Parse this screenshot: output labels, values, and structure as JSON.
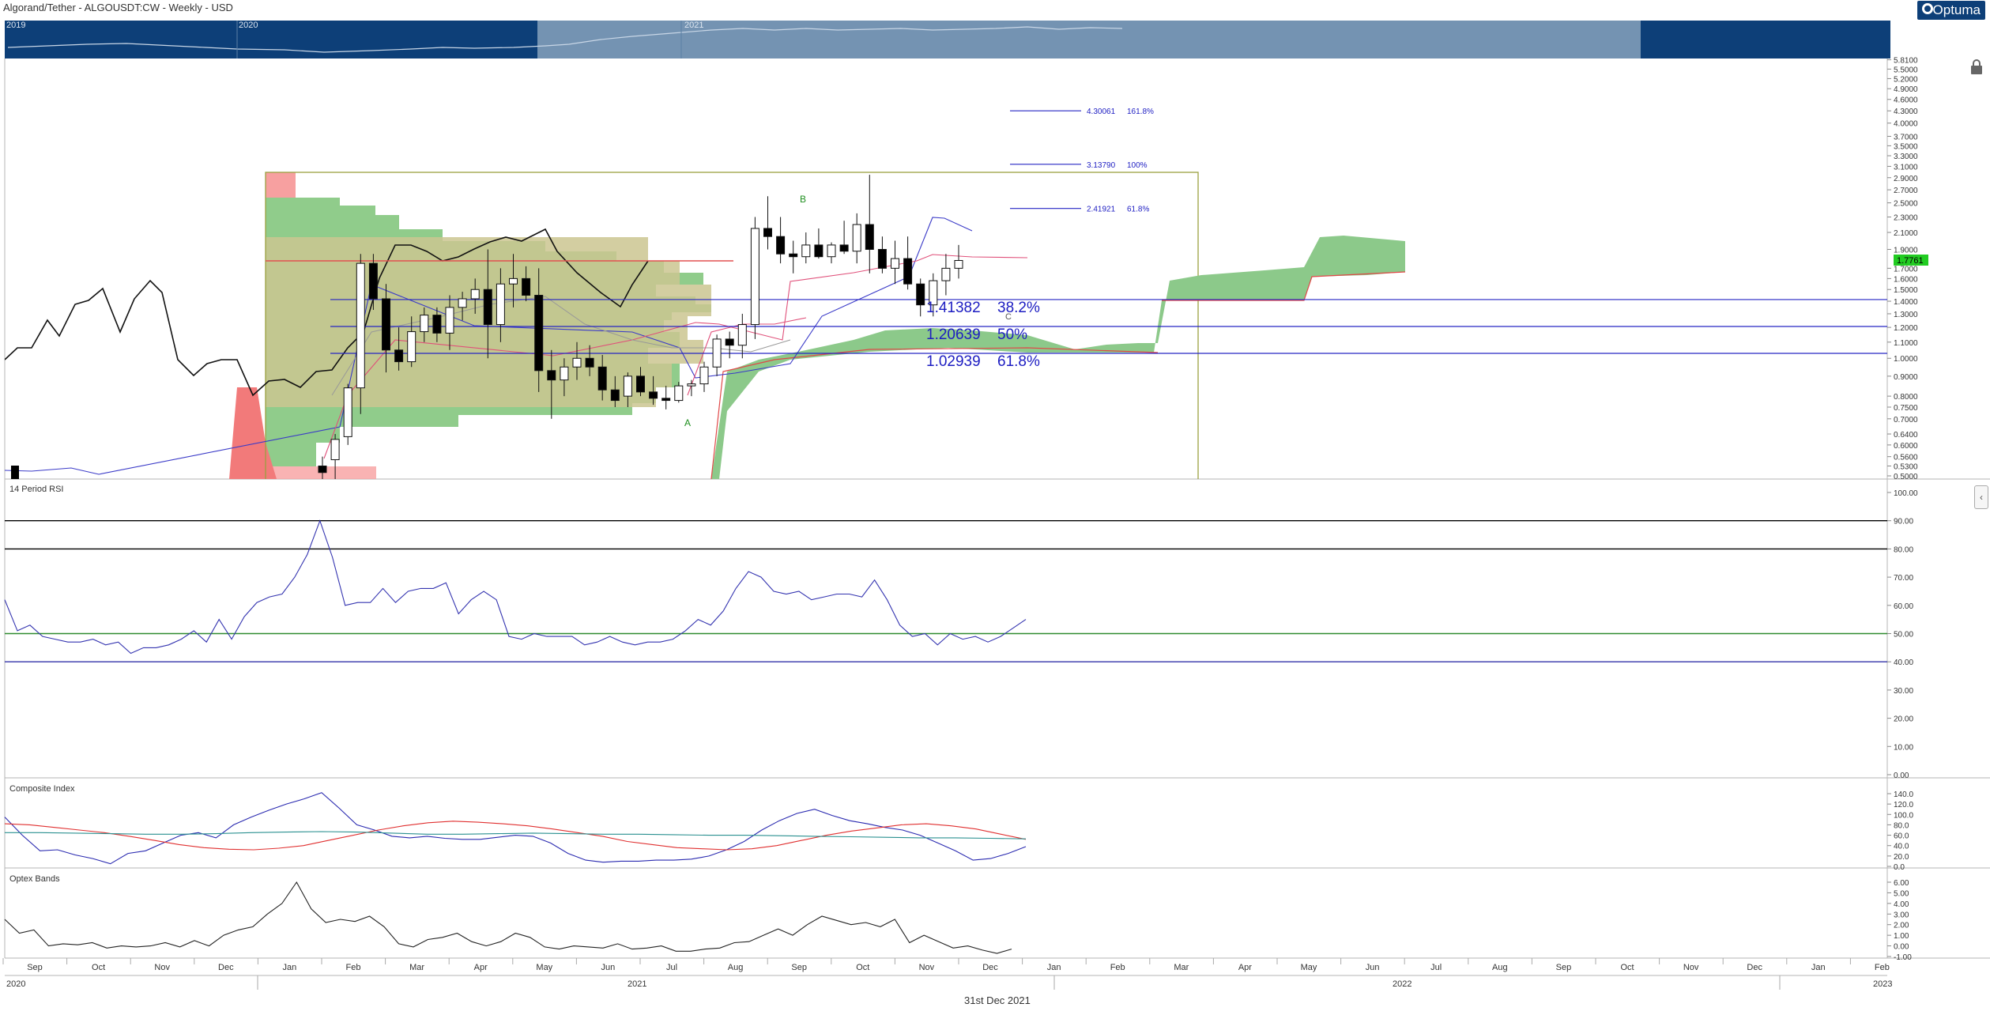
{
  "header": {
    "title": "Algorand/Tether - ALGOUSDT:CW - Weekly - USD",
    "logo_text": "Optuma",
    "footer_date": "31st Dec 2021"
  },
  "navigator": {
    "year_labels": [
      "2019",
      "2020",
      "2021"
    ],
    "colors": {
      "dark": "#0d3f78",
      "selected": "#7493b2"
    }
  },
  "chart_data": [
    {
      "type": "candlestick",
      "panel": "price",
      "scale": "log",
      "ylim": [
        0.5,
        5.8
      ],
      "ticks": [
        "5.8100",
        "5.5000",
        "5.2000",
        "4.9000",
        "4.6000",
        "4.3000",
        "4.0000",
        "3.7000",
        "3.5000",
        "3.3000",
        "3.1000",
        "2.9000",
        "2.7000",
        "2.5000",
        "2.3000",
        "2.1000",
        "1.9000",
        "1.7000",
        "1.6000",
        "1.5000",
        "1.4000",
        "1.3000",
        "1.2000",
        "1.1000",
        "1.0000",
        "0.9000",
        "0.8000",
        "0.7500",
        "0.7000",
        "0.6400",
        "0.6000",
        "0.5600",
        "0.5300",
        "0.5000"
      ],
      "last_price_label": "1.7761",
      "last_price_color": "#22cc22",
      "weeks_start": "2021-01-03",
      "candles": [
        {
          "o": 0.53,
          "h": 0.56,
          "l": 0.49,
          "c": 0.51
        },
        {
          "o": 0.55,
          "h": 0.64,
          "l": 0.48,
          "c": 0.62
        },
        {
          "o": 0.63,
          "h": 0.86,
          "l": 0.6,
          "c": 0.84
        },
        {
          "o": 0.84,
          "h": 1.85,
          "l": 0.72,
          "c": 1.75
        },
        {
          "o": 1.75,
          "h": 1.85,
          "l": 1.33,
          "c": 1.42
        },
        {
          "o": 1.42,
          "h": 1.55,
          "l": 0.92,
          "c": 1.05
        },
        {
          "o": 1.05,
          "h": 1.2,
          "l": 0.93,
          "c": 0.98
        },
        {
          "o": 0.98,
          "h": 1.28,
          "l": 0.95,
          "c": 1.17
        },
        {
          "o": 1.17,
          "h": 1.35,
          "l": 1.1,
          "c": 1.29
        },
        {
          "o": 1.29,
          "h": 1.35,
          "l": 1.1,
          "c": 1.16
        },
        {
          "o": 1.16,
          "h": 1.45,
          "l": 1.05,
          "c": 1.35
        },
        {
          "o": 1.35,
          "h": 1.48,
          "l": 1.25,
          "c": 1.42
        },
        {
          "o": 1.42,
          "h": 1.6,
          "l": 1.3,
          "c": 1.5
        },
        {
          "o": 1.5,
          "h": 1.9,
          "l": 1.0,
          "c": 1.22
        },
        {
          "o": 1.22,
          "h": 1.7,
          "l": 1.1,
          "c": 1.55
        },
        {
          "o": 1.55,
          "h": 1.85,
          "l": 1.35,
          "c": 1.6
        },
        {
          "o": 1.6,
          "h": 1.72,
          "l": 1.4,
          "c": 1.45
        },
        {
          "o": 1.45,
          "h": 1.7,
          "l": 0.82,
          "c": 0.93
        },
        {
          "o": 0.93,
          "h": 1.05,
          "l": 0.7,
          "c": 0.88
        },
        {
          "o": 0.88,
          "h": 1.0,
          "l": 0.8,
          "c": 0.95
        },
        {
          "o": 0.95,
          "h": 1.1,
          "l": 0.88,
          "c": 1.0
        },
        {
          "o": 1.0,
          "h": 1.08,
          "l": 0.9,
          "c": 0.95
        },
        {
          "o": 0.95,
          "h": 1.02,
          "l": 0.78,
          "c": 0.83
        },
        {
          "o": 0.83,
          "h": 0.9,
          "l": 0.75,
          "c": 0.78
        },
        {
          "o": 0.8,
          "h": 0.92,
          "l": 0.75,
          "c": 0.9
        },
        {
          "o": 0.9,
          "h": 0.95,
          "l": 0.8,
          "c": 0.82
        },
        {
          "o": 0.82,
          "h": 0.9,
          "l": 0.76,
          "c": 0.79
        },
        {
          "o": 0.79,
          "h": 0.85,
          "l": 0.74,
          "c": 0.78
        },
        {
          "o": 0.78,
          "h": 0.87,
          "l": 0.77,
          "c": 0.85
        },
        {
          "o": 0.85,
          "h": 0.88,
          "l": 0.8,
          "c": 0.86
        },
        {
          "o": 0.86,
          "h": 0.98,
          "l": 0.82,
          "c": 0.95
        },
        {
          "o": 0.95,
          "h": 1.15,
          "l": 0.9,
          "c": 1.12
        },
        {
          "o": 1.12,
          "h": 1.17,
          "l": 1.0,
          "c": 1.08
        },
        {
          "o": 1.08,
          "h": 1.3,
          "l": 1.0,
          "c": 1.22
        },
        {
          "o": 1.22,
          "h": 2.3,
          "l": 1.12,
          "c": 2.15
        },
        {
          "o": 2.15,
          "h": 2.6,
          "l": 1.9,
          "c": 2.05
        },
        {
          "o": 2.05,
          "h": 2.3,
          "l": 1.75,
          "c": 1.85
        },
        {
          "o": 1.85,
          "h": 2.0,
          "l": 1.65,
          "c": 1.82
        },
        {
          "o": 1.82,
          "h": 2.1,
          "l": 1.75,
          "c": 1.95
        },
        {
          "o": 1.95,
          "h": 2.15,
          "l": 1.8,
          "c": 1.82
        },
        {
          "o": 1.82,
          "h": 1.98,
          "l": 1.75,
          "c": 1.95
        },
        {
          "o": 1.95,
          "h": 2.25,
          "l": 1.85,
          "c": 1.88
        },
        {
          "o": 1.88,
          "h": 2.35,
          "l": 1.75,
          "c": 2.2
        },
        {
          "o": 2.2,
          "h": 2.95,
          "l": 1.65,
          "c": 1.9
        },
        {
          "o": 1.9,
          "h": 2.05,
          "l": 1.65,
          "c": 1.7
        },
        {
          "o": 1.7,
          "h": 2.0,
          "l": 1.55,
          "c": 1.8
        },
        {
          "o": 1.8,
          "h": 2.05,
          "l": 1.5,
          "c": 1.55
        },
        {
          "o": 1.55,
          "h": 1.6,
          "l": 1.28,
          "c": 1.37
        },
        {
          "o": 1.37,
          "h": 1.65,
          "l": 1.28,
          "c": 1.58
        },
        {
          "o": 1.58,
          "h": 1.85,
          "l": 1.45,
          "c": 1.7
        },
        {
          "o": 1.7,
          "h": 1.95,
          "l": 1.6,
          "c": 1.78
        }
      ],
      "fib_retracements": [
        {
          "value": 1.41382,
          "label": "1.41382",
          "pct": "38.2%"
        },
        {
          "value": 1.20639,
          "label": "1.20639",
          "pct": "50%"
        },
        {
          "value": 1.02939,
          "label": "1.02939",
          "pct": "61.8%"
        }
      ],
      "fib_extensions": [
        {
          "value": 4.30061,
          "label": "4.30061",
          "pct": "161.8%"
        },
        {
          "value": 3.1379,
          "label": "3.13790",
          "pct": "100%"
        },
        {
          "value": 2.41921,
          "label": "2.41921",
          "pct": "61.8%"
        }
      ],
      "abc_labels": [
        "A",
        "B",
        "C"
      ],
      "volume_profile_poc": 1.78,
      "box_top": 2.95
    },
    {
      "type": "line",
      "panel": "rsi",
      "title": "14 Period RSI",
      "ylim": [
        0,
        100
      ],
      "ticks": [
        "100.00",
        "90.00",
        "80.00",
        "70.00",
        "60.00",
        "50.00",
        "40.00",
        "30.00",
        "20.00",
        "10.00",
        "0.00"
      ],
      "levels": [
        {
          "value": 90,
          "color": "#000000"
        },
        {
          "value": 80,
          "color": "#000000"
        },
        {
          "value": 50,
          "color": "#2e8b2e"
        },
        {
          "value": 40,
          "color": "#3333aa"
        }
      ],
      "series": [
        {
          "values": [
            62,
            51,
            53,
            49,
            48,
            47,
            47,
            48,
            46,
            47,
            43,
            45,
            45,
            46,
            48,
            51,
            47,
            55,
            48,
            56,
            61,
            63,
            64,
            70,
            78,
            90,
            77,
            60,
            61,
            61,
            66,
            61,
            65,
            66,
            66,
            68,
            57,
            62,
            65,
            62,
            49,
            48,
            50,
            49,
            49,
            49,
            46,
            47,
            49,
            47,
            46,
            47,
            47,
            48,
            51,
            55,
            53,
            58,
            66,
            72,
            70,
            65,
            64,
            65,
            62,
            63,
            64,
            64,
            63,
            69,
            62,
            53,
            49,
            50,
            46,
            50,
            48,
            49,
            47,
            49,
            52,
            55
          ]
        }
      ]
    },
    {
      "type": "line",
      "panel": "composite",
      "title": "Composite Index",
      "ylim": [
        0,
        140
      ],
      "ticks": [
        "140.0",
        "120.0",
        "100.0",
        "80.0",
        "60.0",
        "40.0",
        "20.0",
        "0.0"
      ],
      "series": [
        {
          "values": [
            95,
            60,
            30,
            32,
            22,
            15,
            5,
            25,
            30,
            45,
            60,
            65,
            55,
            80,
            95,
            108,
            120,
            130,
            142,
            112,
            80,
            70,
            58,
            55,
            58,
            54,
            52,
            52,
            56,
            60,
            58,
            45,
            25,
            12,
            8,
            10,
            10,
            12,
            12,
            14,
            20,
            32,
            48,
            70,
            88,
            102,
            110,
            98,
            88,
            82,
            75,
            70,
            60,
            45,
            30,
            12,
            15,
            25,
            38
          ],
          "color": "#2a2ab0"
        },
        {
          "values": [
            82,
            80,
            75,
            70,
            65,
            58,
            50,
            42,
            36,
            33,
            32,
            35,
            40,
            50,
            60,
            70,
            78,
            84,
            87,
            85,
            82,
            78,
            72,
            65,
            58,
            48,
            42,
            36,
            34,
            32,
            34,
            40,
            50,
            60,
            68,
            74,
            80,
            82,
            78,
            72,
            62,
            52
          ],
          "color": "#e03030"
        },
        {
          "values": [
            65,
            65,
            64,
            63,
            62,
            62,
            63,
            65,
            66,
            67,
            66,
            64,
            62,
            62,
            63,
            64,
            63,
            62,
            62,
            61,
            60,
            60,
            59,
            58,
            57,
            56,
            55,
            55,
            54,
            53
          ],
          "color": "#2a9090"
        }
      ]
    },
    {
      "type": "line",
      "panel": "optex",
      "title": "Optex Bands",
      "ylim": [
        -1,
        6
      ],
      "ticks": [
        "6.00",
        "5.00",
        "4.00",
        "3.00",
        "2.00",
        "1.00",
        "0.00",
        "-1.00"
      ],
      "series": [
        {
          "values": [
            2.5,
            1.2,
            1.5,
            0.0,
            0.2,
            0.1,
            0.3,
            -0.2,
            0.0,
            -0.1,
            0.0,
            0.3,
            -0.1,
            0.5,
            0.0,
            1.0,
            1.5,
            1.8,
            3.0,
            4.0,
            6.0,
            3.5,
            2.2,
            2.5,
            2.3,
            2.8,
            1.8,
            0.2,
            -0.1,
            0.6,
            0.8,
            1.2,
            0.4,
            0.0,
            0.4,
            1.2,
            0.8,
            -0.1,
            -0.3,
            0.0,
            -0.1,
            -0.2,
            0.2,
            -0.3,
            -0.2,
            0.0,
            -0.5,
            -0.5,
            -0.3,
            -0.2,
            0.3,
            0.4,
            1.0,
            1.6,
            1.0,
            2.0,
            2.8,
            2.4,
            2.0,
            2.2,
            1.8,
            2.5,
            0.3,
            1.0,
            0.4,
            -0.2,
            0.0,
            -0.4,
            -0.7,
            -0.3
          ]
        }
      ]
    }
  ],
  "x_axis": {
    "month_labels": [
      "Sep",
      "Oct",
      "Nov",
      "Dec",
      "Jan",
      "Feb",
      "Mar",
      "Apr",
      "May",
      "Jun",
      "Jul",
      "Aug",
      "Sep",
      "Oct",
      "Nov",
      "Dec",
      "Jan",
      "Feb",
      "Mar",
      "Apr",
      "May",
      "Jun",
      "Jul",
      "Aug",
      "Sep",
      "Oct",
      "Nov",
      "Dec",
      "Jan",
      "Feb"
    ],
    "year_labels": [
      "2020",
      "2021",
      "2022",
      "2023"
    ]
  },
  "colors": {
    "bull_cloud": "#8cc98a",
    "bear_cloud": "#f07070",
    "fib_blue": "#2626c4",
    "box_olive": "#9aa040",
    "profile_fill": "#c9c48a",
    "profile_green": "#84c67e"
  }
}
